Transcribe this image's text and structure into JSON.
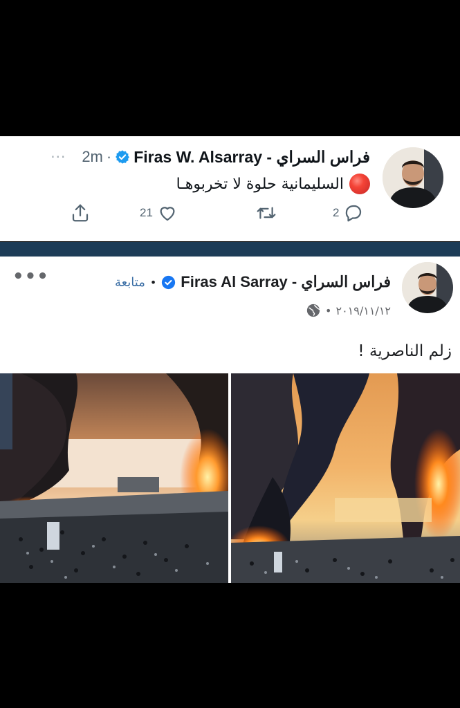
{
  "tweet": {
    "display_name": "Firas W. Alsarray - فراس السراي",
    "time": "2m",
    "separator": "·",
    "more": "···",
    "text": "السليمانية حلوة لا تخربوهـا",
    "replies": "2",
    "likes": "21",
    "icons": [
      "verified-badge-icon",
      "red-circle-emoji",
      "reply-icon",
      "retweet-icon",
      "like-icon",
      "share-icon"
    ],
    "colors": {
      "verified": "#1d9bf0",
      "muted": "#536471"
    }
  },
  "divider_color": "#1d3c57",
  "post": {
    "display_name": "Firas Al Sarray - فراس السراي",
    "follow_label": "متابعة",
    "bullet": "•",
    "more": "•••",
    "date": "٢٠١٩/١١/١٢",
    "date_bullet": "•",
    "caption": "زلم الناصرية !",
    "icons": [
      "verified-badge-icon",
      "globe-icon"
    ],
    "photos": [
      "burning-riverside-photo",
      "burning-protest-photo"
    ]
  }
}
